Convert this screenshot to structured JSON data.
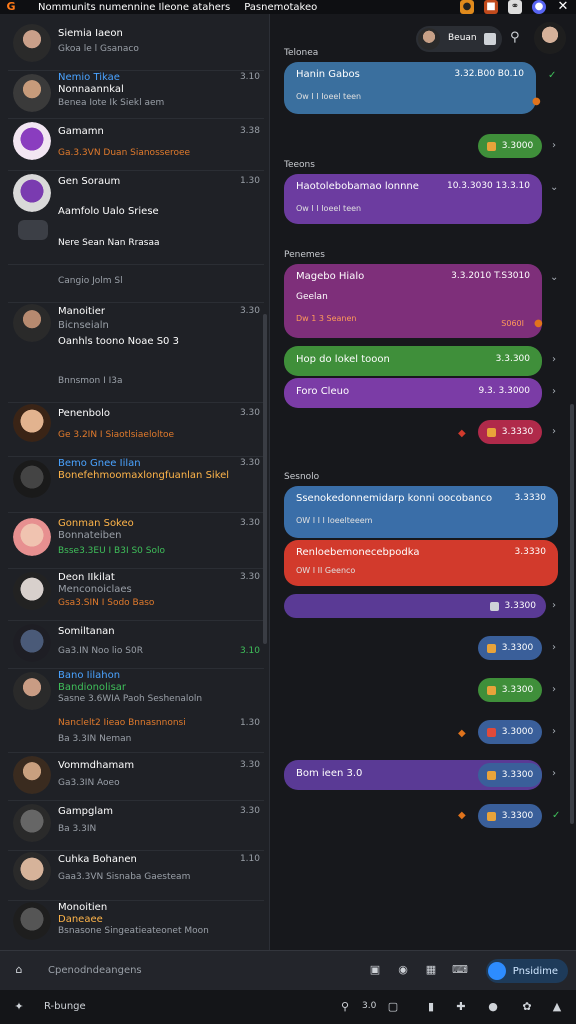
{
  "topbar": {
    "logo": "G",
    "title": "Nommunits numennine Ileone atahers",
    "subtitle": "Pasnemotakeo",
    "icons": [
      "bell-icon",
      "image-icon",
      "link-icon",
      "discord-icon",
      "close-icon"
    ]
  },
  "conversations": [
    {
      "name": "Siemia Iaeon",
      "line1": "Gkoa le  l  Gsanaco",
      "time": ""
    },
    {
      "name": "Nemio  Tikae",
      "name2": "Nonnaannkal",
      "line1": "Benea Iote Ik Siekl aem",
      "time": "3.10"
    },
    {
      "name": "Gamamn",
      "line1": "Ga.3.3VN   Duan   Sianosseroee",
      "time": "3.38"
    },
    {
      "name": "Gen Soraum",
      "line1": "Aamfolo Ualo   Sriese",
      "time": "1.30"
    },
    {
      "name": "",
      "line1": "Nere Sean   Nan Rrasaa",
      "time": ""
    },
    {
      "name": "",
      "line1": "Cangio Jolm   Sl",
      "time": ""
    },
    {
      "name": "Manoitier",
      "name2": "Bicnseialn",
      "line1": "Oanhls toono Noae  S0 3",
      "line2": "Bnnsmon  I  I3a",
      "time": "3.30"
    },
    {
      "name": "Penenbolo",
      "line1": "Ge 3.2IN  I  Siaotlsiaeloltoe",
      "time": "3.30"
    },
    {
      "name": "Bemo Gnee Iilan",
      "name2": "Bonefehmoomaxlongfuanlan Sikel",
      "line1": "",
      "time": "3.30"
    },
    {
      "name": "Gonman Sokeo",
      "name2": "Bonnateiben",
      "line1": "Bsse3.3EU   I   B3I   S0 Solo",
      "time": "3.30"
    },
    {
      "name": "Deon  IIkilat",
      "name2": "Menconoiclaes",
      "line1": "Gsa3.SIN  I   Sodo Baso",
      "time": "3.30"
    },
    {
      "name": "Somiltanan",
      "line1": "Ga3.IN   Noo lio S0R",
      "time": "3.10"
    },
    {
      "name": "Bano Iilahon",
      "name2": "Bandionolisar",
      "line1": "Sasne 3.6WIA  Paoh  Seshenaloln",
      "line2": "Nanclelt2 Iieao   Bnnasnnonsi",
      "line3": "Ba 3.3IN   Neman",
      "time": "1.30"
    },
    {
      "name": "Vommdhamam",
      "line1": "Ga3.3IN    Aoeo",
      "time": "3.30"
    },
    {
      "name": "Gampglam",
      "line1": "Ba 3.3IN",
      "time": "3.30"
    },
    {
      "name": "Cuhka Bohanen",
      "line1": "Gaa3.3VN   Sisnaba   Gaesteam",
      "time": "1.10"
    },
    {
      "name": "Monoitien",
      "name2": "Daneaee",
      "line1": "Bsnasone   Singeatieateonet  Moon",
      "time": ""
    }
  ],
  "chat": {
    "header_user": "Beuan",
    "sections": [
      "Telonea",
      "Teeons",
      "Penemes",
      "Sesnolo"
    ],
    "messages": [
      {
        "text": "Hanin Gabos",
        "meta": "3.32.B00  B0.10",
        "sub": "Ow I I  Ioeel teen",
        "color": "#3a6f9e"
      },
      {
        "text": "Haotolebobamao lonnne",
        "meta": "10.3.3030  13.3.10",
        "sub": "Ow I I  Ioeel teen",
        "color": "#6c3ca0"
      },
      {
        "text": "Magebo Hialo",
        "meta": "3.3.2010  T.S3010",
        "line2": "Geelan",
        "sub": "Dw 1 3  Seanen",
        "color": "#7e2f7a",
        "chip": "S060I"
      },
      {
        "text": "Hop do lokel tooon",
        "meta": "3.3.300",
        "sub": "",
        "color": "#3f8f3a"
      },
      {
        "text": "Foro Cleuo",
        "meta": "9.3.  3.3000",
        "sub": "",
        "color": "#7b3ca6"
      },
      {
        "text": "Ssenokedonnemidarp konni oocobanco",
        "meta": "3.3330",
        "sub": "OW I I  I  Ioeelteeem",
        "color": "#3a6ea8"
      },
      {
        "text": "Renloebemonecebpodka",
        "meta": "3.3330",
        "sub": "OW I II  Geenco",
        "color": "#d23a2c"
      },
      {
        "text": "Bom ieen 3.0",
        "meta": "3.3300",
        "sub": "",
        "color": "#5a3a95"
      }
    ],
    "pills": [
      "3.3000",
      "3.3330",
      "3.3300",
      "3.3300",
      "3.3300",
      "3.3000",
      "3.3300",
      "3.3300"
    ]
  },
  "composer": {
    "placeholder": "Cpenodndeangens",
    "send_label": "Pnsidime"
  },
  "bottombar": {
    "label": "R-bunge",
    "value": "3.0"
  }
}
